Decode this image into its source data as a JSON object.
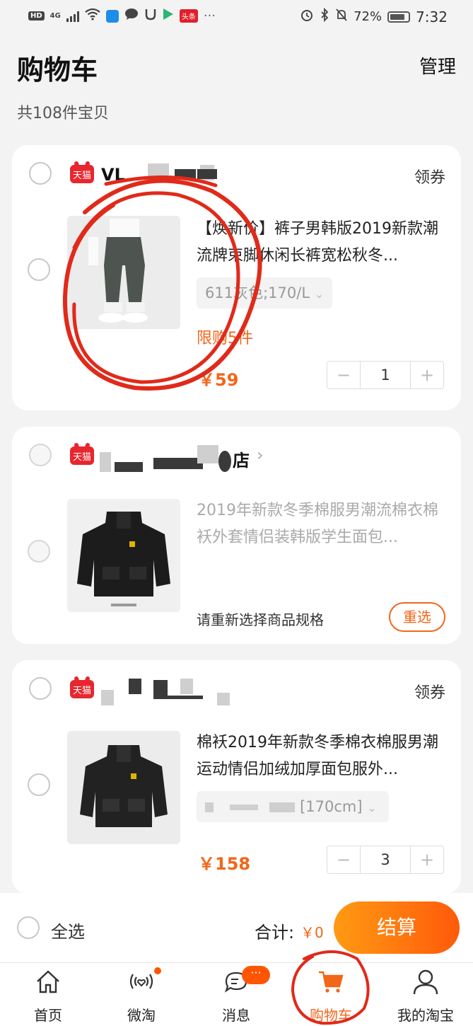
{
  "status_bar": {
    "left_badges": [
      "HD",
      "4G"
    ],
    "battery": "72%",
    "time": "7:32",
    "toutiao": "头条"
  },
  "header": {
    "title": "购物车",
    "manage": "管理",
    "count": "共108件宝贝"
  },
  "cards": [
    {
      "store_badge": "天猫",
      "store_name": "VL",
      "coupon": "领券",
      "title": "【焕新价】裤子男韩版2019新款潮流牌束脚休闲长裤宽松秋冬...",
      "sku": "611灰色;170/L",
      "limit": "限购5件",
      "price": "￥59",
      "quantity": "1"
    },
    {
      "store_badge": "天猫",
      "store_name": "店",
      "title": "2019年新款冬季棉服男潮流棉衣棉袄外套情侣装韩版学生面包...",
      "reselect_hint": "请重新选择商品规格",
      "reselect_button": "重选"
    },
    {
      "store_badge": "天猫",
      "coupon": "领券",
      "title": "棉袄2019年新款冬季棉衣棉服男潮运动情侣加绒加厚面包服外...",
      "sku": "[170cm]",
      "price": "￥158",
      "quantity": "3"
    }
  ],
  "stepper": {
    "minus": "−",
    "plus": "+"
  },
  "checkout": {
    "select_all": "全选",
    "total_label": "合计:",
    "total_value": "￥0",
    "button": "结算"
  },
  "tabs": [
    {
      "label": "首页",
      "icon": "home-icon"
    },
    {
      "label": "微淘",
      "icon": "weitao-icon"
    },
    {
      "label": "消息",
      "icon": "message-icon",
      "badge": "···"
    },
    {
      "label": "购物车",
      "icon": "cart-icon",
      "active": true
    },
    {
      "label": "我的淘宝",
      "icon": "profile-icon"
    }
  ],
  "colors": {
    "accent": "#f2661a",
    "tmall": "#e8262e",
    "annotation": "#e02a1a"
  }
}
